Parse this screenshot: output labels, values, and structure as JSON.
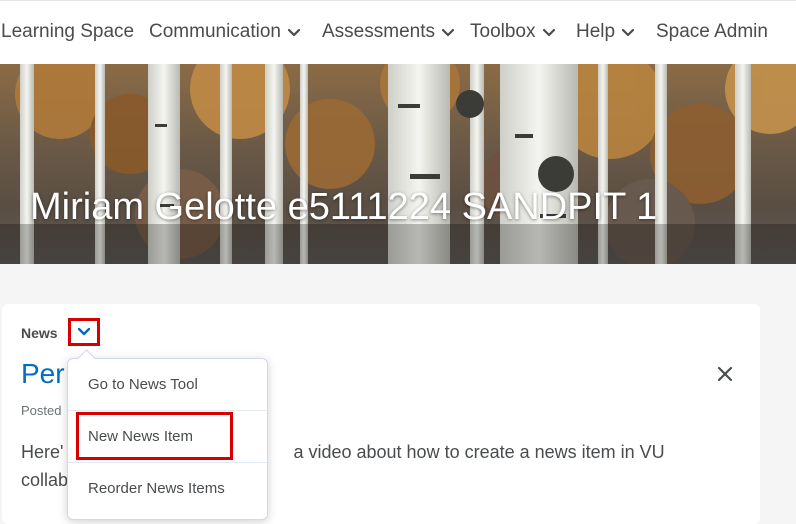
{
  "nav": {
    "items": [
      {
        "label": "Learning Space",
        "has_menu": false
      },
      {
        "label": "Communication",
        "has_menu": true
      },
      {
        "label": "Assessments",
        "has_menu": true
      },
      {
        "label": "Toolbox",
        "has_menu": true
      },
      {
        "label": "Help",
        "has_menu": true
      },
      {
        "label": "Space Admin",
        "has_menu": false
      }
    ]
  },
  "banner": {
    "title": "Miriam Gelotte e5111224 SANDPIT 1"
  },
  "widget": {
    "title": "News",
    "menu_icon": "chevron-down-icon",
    "news_heading": "Per",
    "posted": "Posted",
    "body": "Here's a video about how to create a news item in VU collab",
    "body_start": "Here'",
    "body_rest": "a video about how to create a news item in VU",
    "body_line2": "collab",
    "close_icon": "close-icon"
  },
  "dropdown": {
    "items": [
      "Go to News Tool",
      "New News Item",
      "Reorder News Items"
    ],
    "highlighted": "New News Item"
  },
  "colors": {
    "accent": "#006fbf",
    "highlight_border": "#d60000",
    "text": "#494c4e"
  }
}
